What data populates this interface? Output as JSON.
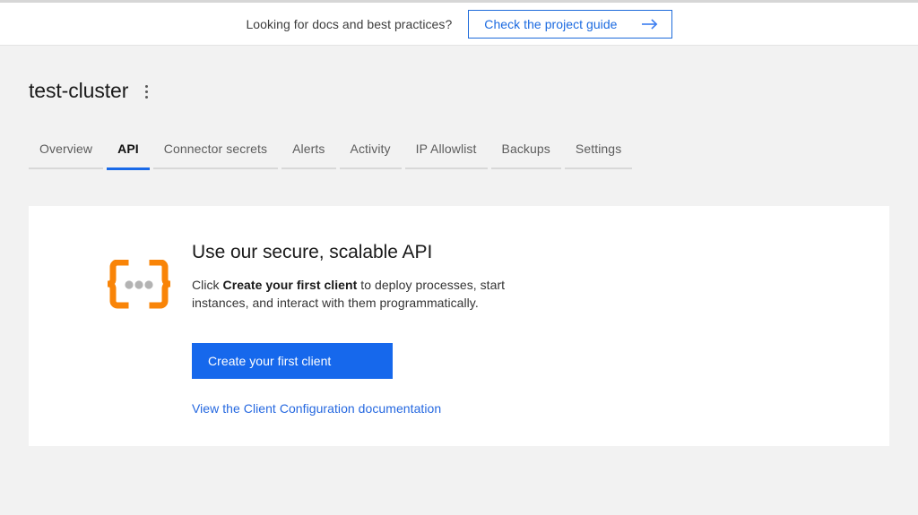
{
  "banner": {
    "text": "Looking for docs and best practices?",
    "cta_label": "Check the project guide",
    "cta_icon": "arrow-right-icon",
    "accent_color": "#1b6ae0"
  },
  "header": {
    "cluster_name": "test-cluster",
    "menu_icon": "kebab-menu-icon"
  },
  "tabs": [
    {
      "label": "Overview",
      "active": false
    },
    {
      "label": "API",
      "active": true
    },
    {
      "label": "Connector secrets",
      "active": false
    },
    {
      "label": "Alerts",
      "active": false
    },
    {
      "label": "Activity",
      "active": false
    },
    {
      "label": "IP Allowlist",
      "active": false
    },
    {
      "label": "Backups",
      "active": false
    },
    {
      "label": "Settings",
      "active": false
    }
  ],
  "card": {
    "icon": "curly-braces-ellipsis-icon",
    "icon_color": "#f98407",
    "icon_dot_color": "#b3b3b3",
    "heading": "Use our secure, scalable API",
    "body_prefix": "Click ",
    "body_emphasis": "Create your first client",
    "body_suffix": " to deploy processes, start instances, and interact with them programmatically.",
    "primary_button_label": "Create your first client",
    "primary_button_color": "#1668ec",
    "doc_link_label": "View the Client Configuration documentation",
    "doc_link_color": "#2568e0"
  }
}
